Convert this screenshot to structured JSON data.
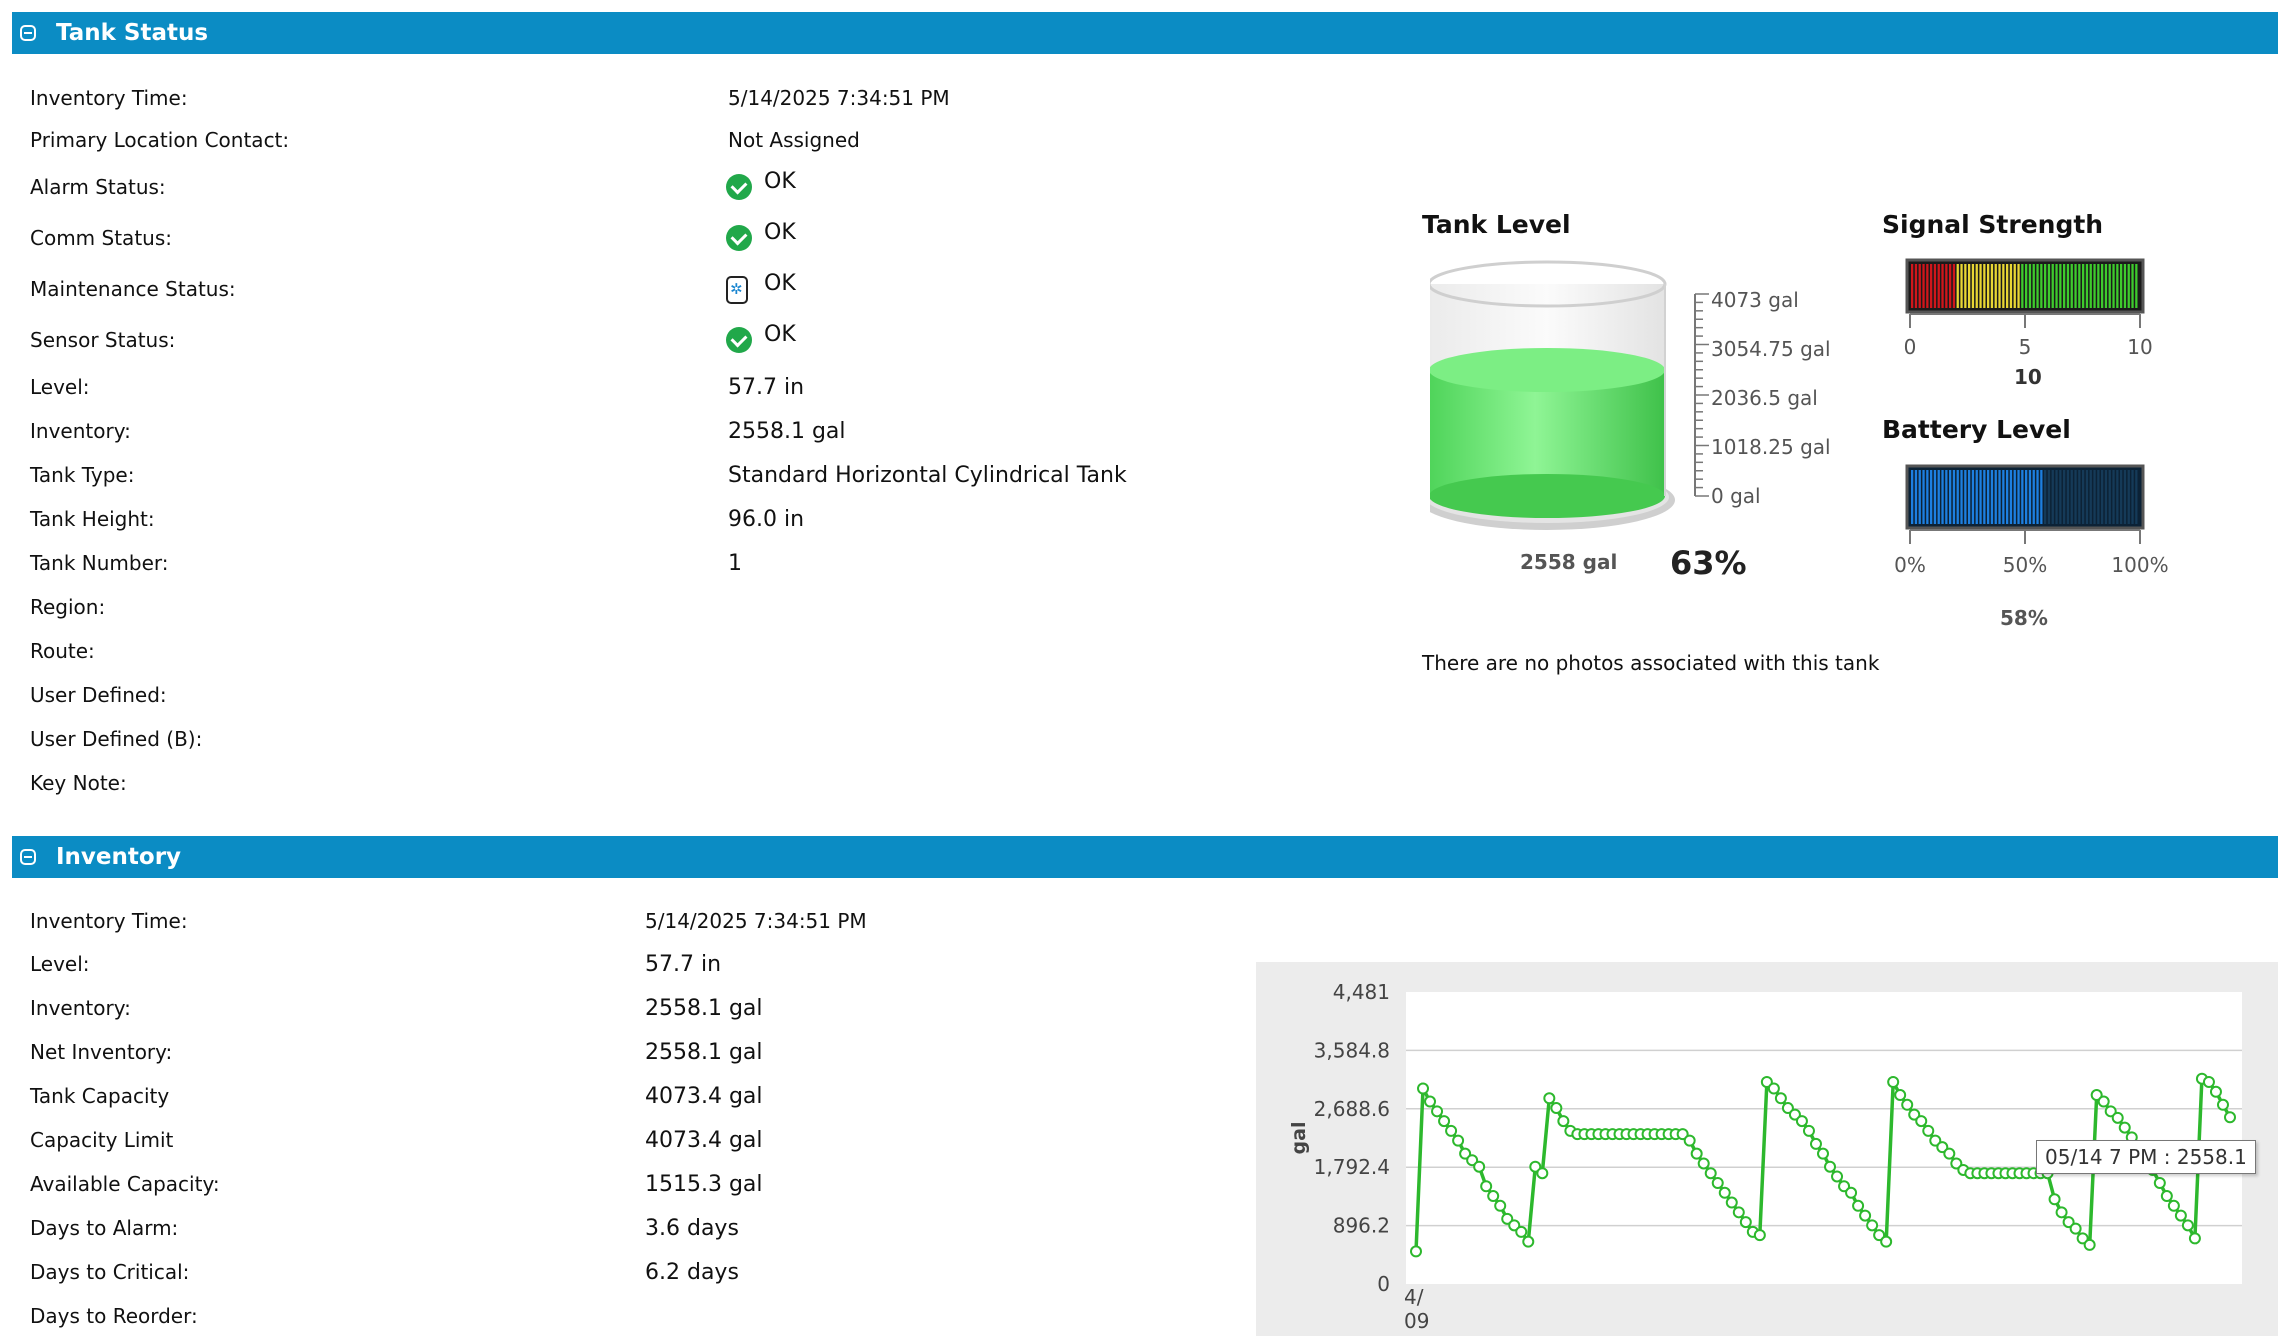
{
  "tank_status": {
    "title": "Tank Status",
    "rows": [
      {
        "label": "Inventory Time:",
        "value": "5/14/2025 7:34:51 PM"
      },
      {
        "label": "Primary Location Contact:",
        "value": "Not Assigned"
      },
      {
        "label": "Alarm Status:",
        "value": "OK",
        "icon": "check-circle-icon"
      },
      {
        "label": "Comm Status:",
        "value": "OK",
        "icon": "check-circle-icon"
      },
      {
        "label": "Maintenance Status:",
        "value": "OK",
        "icon": "maintenance-gear-icon"
      },
      {
        "label": "Sensor Status:",
        "value": "OK",
        "icon": "check-circle-icon"
      },
      {
        "label": "Level:",
        "value": "57.7  in"
      },
      {
        "label": "Inventory:",
        "value": "2558.1  gal"
      },
      {
        "label": "Tank Type:",
        "value": "Standard Horizontal Cylindrical Tank"
      },
      {
        "label": "Tank Height:",
        "value": "96.0  in"
      },
      {
        "label": "Tank Number:",
        "value": "1"
      },
      {
        "label": "Region:",
        "value": ""
      },
      {
        "label": "Route:",
        "value": ""
      },
      {
        "label": "User Defined:",
        "value": ""
      },
      {
        "label": "User Defined (B):",
        "value": ""
      },
      {
        "label": "Key Note:",
        "value": ""
      }
    ]
  },
  "tank_level": {
    "title": "Tank Level",
    "fill_fraction": 0.63,
    "scale_labels": [
      "4073 gal",
      "3054.75 gal",
      "2036.5 gal",
      "1018.25 gal",
      "0 gal"
    ],
    "gallons_label": "2558 gal",
    "percent_label": "63%",
    "fill_color": "#5fe36a"
  },
  "signal_strength": {
    "title": "Signal Strength",
    "value": 10,
    "max": 10,
    "ticks": [
      "0",
      "5",
      "10"
    ],
    "value_label": "10"
  },
  "battery_level": {
    "title": "Battery Level",
    "fraction": 0.58,
    "ticks": [
      "0%",
      "50%",
      "100%"
    ],
    "value_label": "58%"
  },
  "photos_note": "There are no photos associated with this tank",
  "inventory": {
    "title": "Inventory",
    "rows": [
      {
        "label": "Inventory Time:",
        "value": "5/14/2025 7:34:51 PM"
      },
      {
        "label": "Level:",
        "value": "57.7  in"
      },
      {
        "label": "Inventory:",
        "value": "2558.1  gal"
      },
      {
        "label": "Net Inventory:",
        "value": "2558.1  gal"
      },
      {
        "label": "Tank Capacity",
        "value": "4073.4  gal"
      },
      {
        "label": "Capacity Limit",
        "value": "4073.4  gal"
      },
      {
        "label": "Available Capacity:",
        "value": "1515.3  gal"
      },
      {
        "label": "Days to Alarm:",
        "value": "3.6  days"
      },
      {
        "label": "Days to Critical:",
        "value": "6.2  days"
      },
      {
        "label": "Days to Reorder:",
        "value": ""
      }
    ]
  },
  "chart_data": {
    "type": "line",
    "ylabel": "gal",
    "ylim": [
      0,
      4481
    ],
    "yticks": [
      "4,481",
      "3,584.8",
      "2,688.6",
      "1,792.4",
      "896.2",
      "0"
    ],
    "x_first_label": "4/\n09",
    "x_first_label_lines": [
      "4/",
      "09"
    ],
    "line_color": "#2db82d",
    "values": [
      500,
      3000,
      2800,
      2650,
      2500,
      2350,
      2200,
      2000,
      1900,
      1800,
      1500,
      1350,
      1200,
      1000,
      900,
      800,
      650,
      1800,
      1700,
      2850,
      2700,
      2500,
      2350,
      2300,
      2300,
      2300,
      2300,
      2300,
      2300,
      2300,
      2300,
      2300,
      2300,
      2300,
      2300,
      2300,
      2300,
      2300,
      2300,
      2200,
      2000,
      1850,
      1700,
      1550,
      1400,
      1250,
      1100,
      950,
      800,
      750,
      3100,
      3000,
      2850,
      2700,
      2600,
      2500,
      2350,
      2150,
      2000,
      1800,
      1650,
      1500,
      1400,
      1200,
      1050,
      900,
      750,
      650,
      3100,
      2900,
      2750,
      2600,
      2500,
      2350,
      2200,
      2100,
      2000,
      1850,
      1750,
      1700,
      1700,
      1700,
      1700,
      1700,
      1700,
      1700,
      1700,
      1700,
      1700,
      1700,
      1700,
      1300,
      1100,
      950,
      850,
      700,
      600,
      2900,
      2800,
      2650,
      2550,
      2400,
      2250,
      2050,
      1900,
      1750,
      1550,
      1350,
      1200,
      1050,
      900,
      700,
      3150,
      3100,
      2950,
      2750,
      2558.1
    ],
    "tooltip": "05/14 7 PM : 2558.1"
  }
}
